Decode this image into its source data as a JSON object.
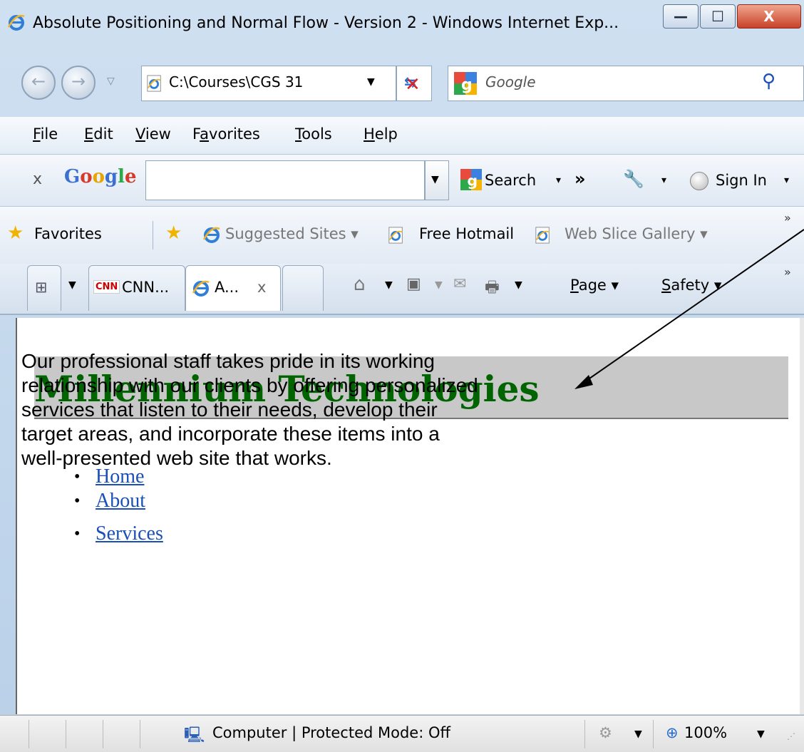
{
  "window": {
    "title": "Absolute Positioning and Normal Flow - Version 2 - Windows Internet Exp...",
    "minimize": "—",
    "maximize": "☐",
    "close": "X"
  },
  "navbar": {
    "address": "C:\\Courses\\CGS 31",
    "search_placeholder": "Google"
  },
  "menu": {
    "items": [
      "File",
      "Edit",
      "View",
      "Favorites",
      "Tools",
      "Help"
    ],
    "accesskeys": [
      "F",
      "E",
      "V",
      "a",
      "T",
      "H"
    ]
  },
  "google_toolbar": {
    "close": "x",
    "logo": "Google",
    "search_label": "Search",
    "more": "»",
    "sign_in": "Sign In"
  },
  "favorites_bar": {
    "favorites": "Favorites",
    "suggested": "Suggested Sites ▾",
    "hotmail": "Free Hotmail",
    "slice": "Web Slice Gallery ▾",
    "more": "»"
  },
  "tabs": {
    "tab1": "CNN...",
    "tab1_badge": "CNN",
    "tab2": "A...",
    "tab2_close": "x",
    "page": "Page ▾",
    "safety": "Safety ▾",
    "more": "»"
  },
  "content": {
    "header": "Millennium Technologies",
    "paragraph": "Our professional staff takes pride in its working relationship with our clients by offering personalized services that listen to their needs, develop their target areas, and incorporate these items into a well-presented web site that works.",
    "nav": [
      "Home",
      "About",
      "Services"
    ]
  },
  "status": {
    "zone": "Computer | Protected Mode: Off",
    "zoom": "100%"
  },
  "colors": {
    "header_text": "#006400",
    "header_band": "#c8c8c8",
    "link": "#1a4fb8"
  }
}
